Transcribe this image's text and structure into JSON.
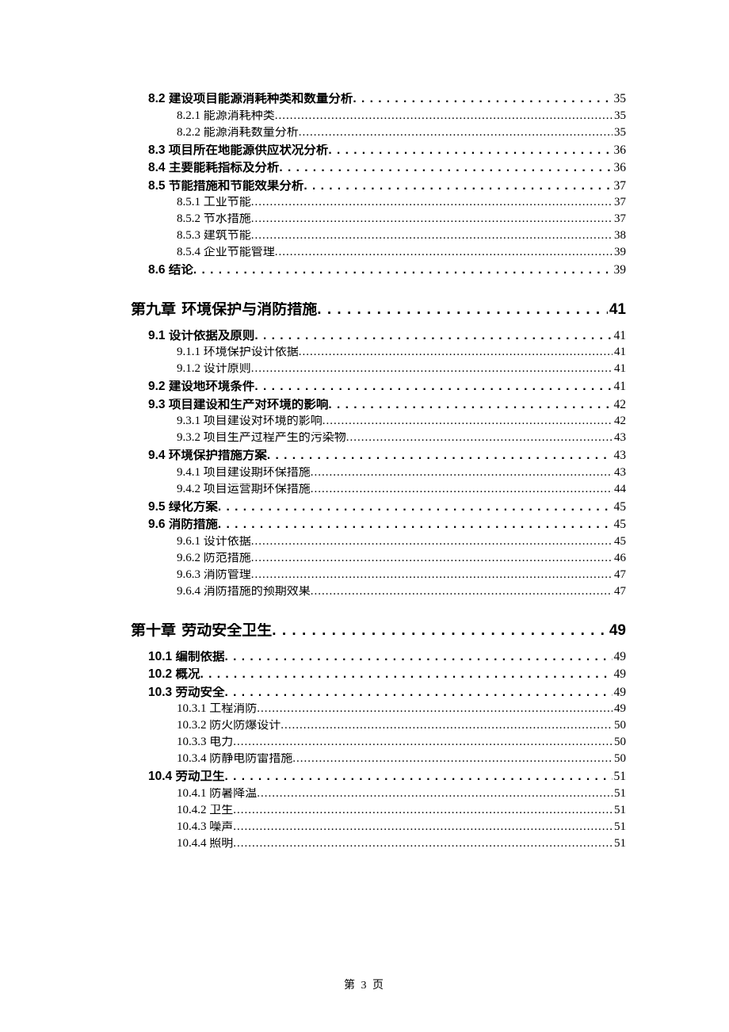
{
  "footer": "第 3 页",
  "toc": [
    {
      "level": "l2",
      "title": "8.2 建设项目能源消耗种类和数量分析",
      "page": "35"
    },
    {
      "level": "l3",
      "title": "8.2.1 能源消耗种类",
      "page": "35"
    },
    {
      "level": "l3",
      "title": "8.2.2 能源消耗数量分析",
      "page": "35"
    },
    {
      "level": "l2",
      "title": "8.3 项目所在地能源供应状况分析",
      "page": "36"
    },
    {
      "level": "l2",
      "title": "8.4 主要能耗指标及分析",
      "page": "36"
    },
    {
      "level": "l2",
      "title": "8.5 节能措施和节能效果分析",
      "page": "37"
    },
    {
      "level": "l3",
      "title": "8.5.1 工业节能",
      "page": "37"
    },
    {
      "level": "l3",
      "title": "8.5.2 节水措施",
      "page": "37"
    },
    {
      "level": "l3",
      "title": "8.5.3 建筑节能",
      "page": "38"
    },
    {
      "level": "l3",
      "title": "8.5.4 企业节能管理",
      "page": "39"
    },
    {
      "level": "l2",
      "title": "8.6 结论",
      "page": "39"
    },
    {
      "level": "chapter",
      "title": "第九章 环境保护与消防措施",
      "page": "41"
    },
    {
      "level": "l2",
      "title": "9.1 设计依据及原则",
      "page": "41"
    },
    {
      "level": "l3",
      "title": "9.1.1 环境保护设计依据",
      "page": "41"
    },
    {
      "level": "l3",
      "title": "9.1.2 设计原则",
      "page": "41"
    },
    {
      "level": "l2",
      "title": "9.2 建设地环境条件",
      "page": "41"
    },
    {
      "level": "l2",
      "title": "9.3  项目建设和生产对环境的影响",
      "page": "42"
    },
    {
      "level": "l3",
      "title": "9.3.1  项目建设对环境的影响",
      "page": "42"
    },
    {
      "level": "l3",
      "title": "9.3.2  项目生产过程产生的污染物",
      "page": "43"
    },
    {
      "level": "l2",
      "title": "9.4  环境保护措施方案",
      "page": "43"
    },
    {
      "level": "l3",
      "title": "9.4.1  项目建设期环保措施",
      "page": "43"
    },
    {
      "level": "l3",
      "title": "9.4.2  项目运营期环保措施",
      "page": "44"
    },
    {
      "level": "l2",
      "title": "9.5 绿化方案",
      "page": "45"
    },
    {
      "level": "l2",
      "title": "9.6 消防措施",
      "page": "45"
    },
    {
      "level": "l3",
      "title": "9.6.1 设计依据",
      "page": "45"
    },
    {
      "level": "l3",
      "title": "9.6.2 防范措施",
      "page": "46"
    },
    {
      "level": "l3",
      "title": "9.6.3 消防管理",
      "page": "47"
    },
    {
      "level": "l3",
      "title": "9.6.4 消防措施的预期效果",
      "page": "47"
    },
    {
      "level": "chapter",
      "title": "第十章 劳动安全卫生",
      "page": "49"
    },
    {
      "level": "l2",
      "title": "10.1  编制依据",
      "page": "49"
    },
    {
      "level": "l2",
      "title": "10.2 概况",
      "page": "49"
    },
    {
      "level": "l2",
      "title": "10.3  劳动安全",
      "page": "49"
    },
    {
      "level": "l3",
      "title": "10.3.1 工程消防",
      "page": "49"
    },
    {
      "level": "l3",
      "title": "10.3.2 防火防爆设计",
      "page": "50"
    },
    {
      "level": "l3",
      "title": "10.3.3 电力",
      "page": "50"
    },
    {
      "level": "l3",
      "title": "10.3.4 防静电防雷措施",
      "page": "50"
    },
    {
      "level": "l2",
      "title": "10.4 劳动卫生",
      "page": "51"
    },
    {
      "level": "l3",
      "title": "10.4.1 防暑降温",
      "page": "51"
    },
    {
      "level": "l3",
      "title": "10.4.2 卫生",
      "page": "51"
    },
    {
      "level": "l3",
      "title": "10.4.3 噪声",
      "page": "51"
    },
    {
      "level": "l3",
      "title": "10.4.4 照明",
      "page": "51"
    }
  ]
}
